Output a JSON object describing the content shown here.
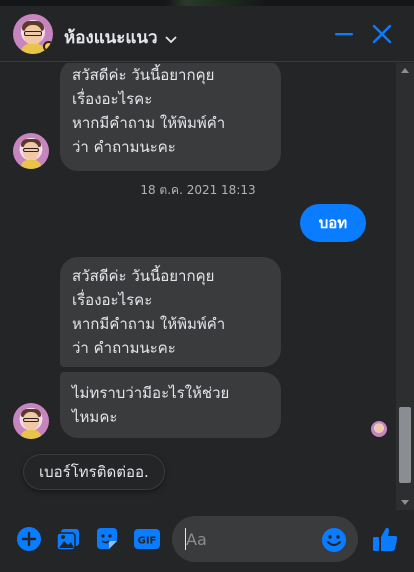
{
  "header": {
    "title": "ห้องแนะแนว",
    "avatar_icon": "profile-avatar-icon",
    "minimize_icon": "minimize-icon",
    "close_icon": "close-icon",
    "accent_color": "#0a7cff"
  },
  "messages": {
    "first_bubble": [
      "สวัสดีค่ะ วันนี้อยากคุย",
      "เรื่องอะไรคะ",
      "หากมีคำถาม ให้พิมพ์คำ",
      "ว่า คำถามนะคะ"
    ],
    "timestamp": "18 ต.ค. 2021 18:13",
    "outgoing": "บอท",
    "second_bubble": [
      "สวัสดีค่ะ วันนี้อยากคุย",
      "เรื่องอะไรคะ",
      "หากมีคำถาม ให้พิมพ์คำ",
      "ว่า คำถามนะคะ"
    ],
    "third_bubble": [
      "ไม่ทราบว่ามีอะไรให้ช่วย",
      "ไหมคะ"
    ]
  },
  "quick_reply": {
    "label": "เบอร์โทรติดต่ออ."
  },
  "composer": {
    "placeholder": "Aa",
    "icons": [
      "plus-circle-icon",
      "image-icon",
      "sticker-icon",
      "gif-icon",
      "emoji-icon",
      "thumbs-up-icon"
    ]
  },
  "colors": {
    "background": "#242526",
    "incoming_bubble": "#3a3b3c",
    "outgoing_bubble": "#0a7cff",
    "text": "#e4e6eb",
    "muted": "#b0b3b8"
  }
}
